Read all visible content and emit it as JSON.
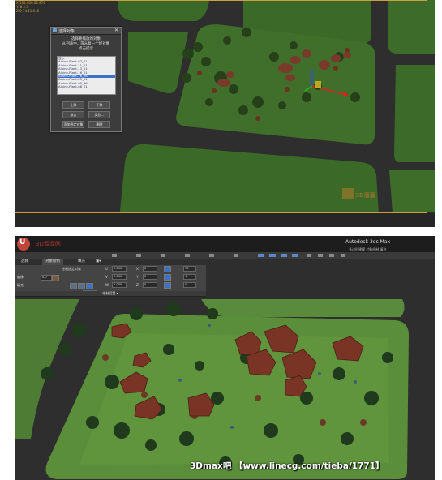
{
  "top_view": {
    "hud_lines": [
      "X:104.808.02.876",
      "Y:-8.2.3",
      "Z:0 74.11.646"
    ],
    "dialog": {
      "title": "选择对象",
      "close": "✕",
      "hint_lines": [
        "选择要缩放的对象",
        "从列表中，或从复一个好对象",
        "点击提示"
      ],
      "list_items": [
        "显示",
        "Alpine-Plant-07_01",
        "Alpine-Plant-11_01",
        "Alpine-Plant-13_01",
        "Alpine-Plant-16_01",
        "Alpine-Plant-16_36",
        "Alpine-Plant-05_01",
        "Alpine-Plant-05_36",
        "Alpine-Plant-08_01"
      ],
      "selected_index": 5,
      "buttons": [
        "上移",
        "下移",
        "按名",
        "类别...",
        "添加选定对象",
        "删除"
      ]
    },
    "site_logo_text": "3D溜溜"
  },
  "bottom_view": {
    "app_logo": "U",
    "red_title": "3D溜溜网",
    "window_title": "Autodesk 3ds Max",
    "window_hint": "多边形建模  对象绘制  填充",
    "tabs": [
      "选择",
      "对象绘制",
      "填充",
      "▣▾"
    ],
    "active_tab": 1,
    "ribbon": {
      "brush_label": "绘制选定对象",
      "offset_label": "偏移",
      "offset_value": "0.0",
      "space_label": "间距",
      "space_value": "70.0",
      "fill_label": "填充",
      "scale_labels": [
        "U",
        "V",
        "W"
      ],
      "scale_values": [
        "0.000",
        "0.000",
        "0.000"
      ],
      "axis_labels": [
        "X",
        "Y",
        "Z"
      ],
      "axis_values": [
        "0",
        "0",
        "0"
      ],
      "misc_values": [
        "90",
        "1",
        "0"
      ],
      "section_title": "绘制设置 ▾"
    },
    "watermark": "3Dmax吧 【www.linecg.com/tieba/1771】"
  },
  "colors": {
    "grass": "#3e6a2a",
    "grass_light": "#5c8a3a",
    "road": "#2f2f2f",
    "rock": "#6b2f22",
    "selected": "#3a72c8"
  }
}
